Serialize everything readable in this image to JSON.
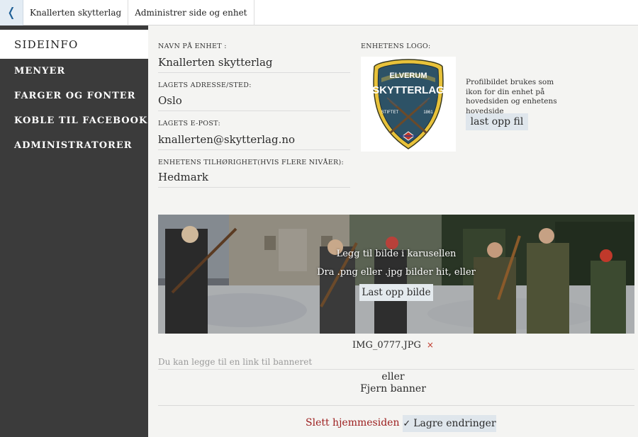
{
  "topbar": {
    "back_icon": "chevron-left-icon",
    "back_glyph": "❬",
    "crumbs": [
      "Knallerten skytterlag",
      "Administrer side og enhet"
    ]
  },
  "sidebar": {
    "items": [
      {
        "label": "SIDEINFO",
        "active": true
      },
      {
        "label": "MENYER",
        "active": false
      },
      {
        "label": "FARGER OG FONTER",
        "active": false
      },
      {
        "label": "KOBLE TIL FACEBOOK",
        "active": false
      },
      {
        "label": "ADMINISTRATORER",
        "active": false
      }
    ]
  },
  "form": {
    "name_label": "NAVN PÅ ENHET :",
    "name_value": "Knallerten skytterlag",
    "address_label": "LAGETS ADRESSE/STED:",
    "address_value": "Oslo",
    "email_label": "LAGETS E-POST:",
    "email_value": "knallerten@skytterlag.no",
    "affiliation_label": "ENHETENS TILHØRIGHET(HVIS FLERE NIVÅER):",
    "affiliation_value": "Hedmark"
  },
  "logo": {
    "label": "ENHETENS LOGO:",
    "top_text": "ELVERUM",
    "main_text": "SKYTTERLAG",
    "left_text": "STIFTET",
    "right_text": "1861",
    "description": "Profilbildet brukes som ikon for din enhet på hovedsiden og enhetens hovedside",
    "upload_label": "last opp fil"
  },
  "banner": {
    "add_text": "Legg til bilde i karusellen",
    "drag_text": "Dra .png eller .jpg bilder hit, eller",
    "upload_label": "Last opp bilde",
    "filename": "IMG_0777.JPG",
    "remove_glyph": "×",
    "link_placeholder": "Du kan legge til en link til banneret",
    "or_text": "eller",
    "remove_banner_label": "Fjern banner"
  },
  "actions": {
    "delete_label": "Slett hjemmesiden",
    "save_glyph": "✓",
    "save_label": "Lagre endringer"
  },
  "colors": {
    "sidebar_bg": "#3b3b3b",
    "main_bg": "#f4f4f2",
    "button_bg": "#dfe6ec",
    "danger": "#9b1c1c",
    "link_blue": "#1e5f96"
  }
}
